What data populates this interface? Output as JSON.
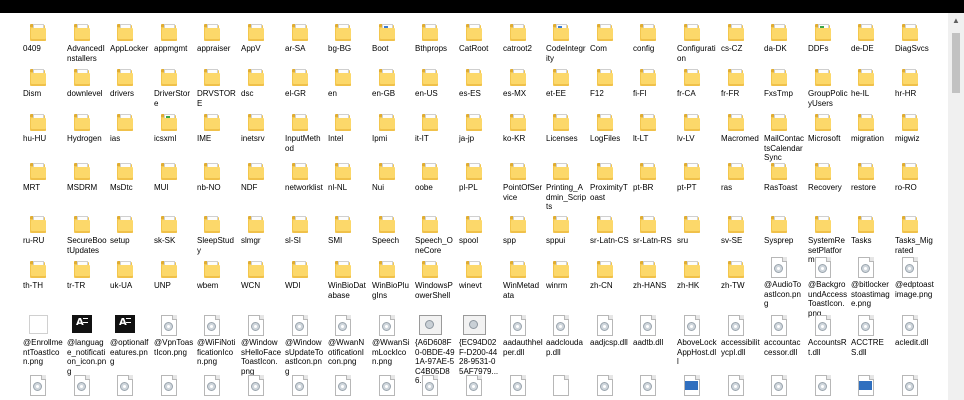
{
  "pane": {
    "rows": [
      [
        {
          "label": "0409",
          "kind": "folder"
        },
        {
          "label": "AdvancedInstallers",
          "kind": "folder"
        },
        {
          "label": "AppLocker",
          "kind": "folder"
        },
        {
          "label": "appmgmt",
          "kind": "folder"
        },
        {
          "label": "appraiser",
          "kind": "folder"
        },
        {
          "label": "AppV",
          "kind": "folder"
        },
        {
          "label": "ar-SA",
          "kind": "folder"
        },
        {
          "label": "bg-BG",
          "kind": "folder"
        },
        {
          "label": "Boot",
          "kind": "folder-doc"
        },
        {
          "label": "Bthprops",
          "kind": "folder"
        },
        {
          "label": "CatRoot",
          "kind": "folder"
        },
        {
          "label": "catroot2",
          "kind": "folder"
        },
        {
          "label": "CodeIntegrity",
          "kind": "folder-doc"
        },
        {
          "label": "Com",
          "kind": "folder"
        },
        {
          "label": "config",
          "kind": "folder"
        },
        {
          "label": "Configuration",
          "kind": "folder"
        },
        {
          "label": "cs-CZ",
          "kind": "folder"
        },
        {
          "label": "da-DK",
          "kind": "folder"
        },
        {
          "label": "DDFs",
          "kind": "folder-green"
        },
        {
          "label": "de-DE",
          "kind": "folder"
        },
        {
          "label": "DiagSvcs",
          "kind": "folder"
        }
      ],
      [
        {
          "label": "Dism",
          "kind": "folder"
        },
        {
          "label": "downlevel",
          "kind": "folder"
        },
        {
          "label": "drivers",
          "kind": "folder"
        },
        {
          "label": "DriverStore",
          "kind": "folder"
        },
        {
          "label": "DRVSTORE",
          "kind": "folder"
        },
        {
          "label": "dsc",
          "kind": "folder"
        },
        {
          "label": "el-GR",
          "kind": "folder"
        },
        {
          "label": "en",
          "kind": "folder"
        },
        {
          "label": "en-GB",
          "kind": "folder"
        },
        {
          "label": "en-US",
          "kind": "folder"
        },
        {
          "label": "es-ES",
          "kind": "folder"
        },
        {
          "label": "es-MX",
          "kind": "folder"
        },
        {
          "label": "et-EE",
          "kind": "folder"
        },
        {
          "label": "F12",
          "kind": "folder"
        },
        {
          "label": "fi-FI",
          "kind": "folder"
        },
        {
          "label": "fr-CA",
          "kind": "folder"
        },
        {
          "label": "fr-FR",
          "kind": "folder"
        },
        {
          "label": "FxsTmp",
          "kind": "folder"
        },
        {
          "label": "GroupPolicyUsers",
          "kind": "folder"
        },
        {
          "label": "he-IL",
          "kind": "folder"
        },
        {
          "label": "hr-HR",
          "kind": "folder"
        }
      ],
      [
        {
          "label": "hu-HU",
          "kind": "folder"
        },
        {
          "label": "Hydrogen",
          "kind": "folder"
        },
        {
          "label": "ias",
          "kind": "folder"
        },
        {
          "label": "icsxml",
          "kind": "folder-green"
        },
        {
          "label": "IME",
          "kind": "folder"
        },
        {
          "label": "inetsrv",
          "kind": "folder"
        },
        {
          "label": "InputMethod",
          "kind": "folder"
        },
        {
          "label": "Intel",
          "kind": "folder"
        },
        {
          "label": "Ipmi",
          "kind": "folder"
        },
        {
          "label": "it-IT",
          "kind": "folder"
        },
        {
          "label": "ja-jp",
          "kind": "folder"
        },
        {
          "label": "ko-KR",
          "kind": "folder"
        },
        {
          "label": "Licenses",
          "kind": "folder"
        },
        {
          "label": "LogFiles",
          "kind": "folder"
        },
        {
          "label": "lt-LT",
          "kind": "folder"
        },
        {
          "label": "lv-LV",
          "kind": "folder"
        },
        {
          "label": "Macromed",
          "kind": "folder"
        },
        {
          "label": "MailContactsCalendarSync",
          "kind": "folder"
        },
        {
          "label": "Microsoft",
          "kind": "folder"
        },
        {
          "label": "migration",
          "kind": "folder"
        },
        {
          "label": "migwiz",
          "kind": "folder"
        }
      ],
      [
        {
          "label": "MRT",
          "kind": "folder"
        },
        {
          "label": "MSDRM",
          "kind": "folder"
        },
        {
          "label": "MsDtc",
          "kind": "folder"
        },
        {
          "label": "MUI",
          "kind": "folder"
        },
        {
          "label": "nb-NO",
          "kind": "folder"
        },
        {
          "label": "NDF",
          "kind": "folder"
        },
        {
          "label": "networklist",
          "kind": "folder"
        },
        {
          "label": "nl-NL",
          "kind": "folder"
        },
        {
          "label": "Nui",
          "kind": "folder"
        },
        {
          "label": "oobe",
          "kind": "folder"
        },
        {
          "label": "pl-PL",
          "kind": "folder"
        },
        {
          "label": "PointOfService",
          "kind": "folder"
        },
        {
          "label": "Printing_Admin_Scripts",
          "kind": "folder"
        },
        {
          "label": "ProximityToast",
          "kind": "folder"
        },
        {
          "label": "pt-BR",
          "kind": "folder"
        },
        {
          "label": "pt-PT",
          "kind": "folder"
        },
        {
          "label": "ras",
          "kind": "folder"
        },
        {
          "label": "RasToast",
          "kind": "folder"
        },
        {
          "label": "Recovery",
          "kind": "folder"
        },
        {
          "label": "restore",
          "kind": "folder"
        },
        {
          "label": "ro-RO",
          "kind": "folder"
        }
      ],
      [
        {
          "label": "ru-RU",
          "kind": "folder"
        },
        {
          "label": "SecureBootUpdates",
          "kind": "folder"
        },
        {
          "label": "setup",
          "kind": "folder"
        },
        {
          "label": "sk-SK",
          "kind": "folder"
        },
        {
          "label": "SleepStudy",
          "kind": "folder"
        },
        {
          "label": "slmgr",
          "kind": "folder"
        },
        {
          "label": "sl-SI",
          "kind": "folder"
        },
        {
          "label": "SMI",
          "kind": "folder"
        },
        {
          "label": "Speech",
          "kind": "folder"
        },
        {
          "label": "Speech_OneCore",
          "kind": "folder"
        },
        {
          "label": "spool",
          "kind": "folder"
        },
        {
          "label": "spp",
          "kind": "folder"
        },
        {
          "label": "sppui",
          "kind": "folder"
        },
        {
          "label": "sr-Latn-CS",
          "kind": "folder"
        },
        {
          "label": "sr-Latn-RS",
          "kind": "folder"
        },
        {
          "label": "sru",
          "kind": "folder"
        },
        {
          "label": "sv-SE",
          "kind": "folder"
        },
        {
          "label": "Sysprep",
          "kind": "folder"
        },
        {
          "label": "SystemResetPlatform",
          "kind": "folder"
        },
        {
          "label": "Tasks",
          "kind": "folder"
        },
        {
          "label": "Tasks_Migrated",
          "kind": "folder"
        }
      ],
      [
        {
          "label": "th-TH",
          "kind": "folder"
        },
        {
          "label": "tr-TR",
          "kind": "folder"
        },
        {
          "label": "uk-UA",
          "kind": "folder"
        },
        {
          "label": "UNP",
          "kind": "folder"
        },
        {
          "label": "wbem",
          "kind": "folder"
        },
        {
          "label": "WCN",
          "kind": "folder"
        },
        {
          "label": "WDI",
          "kind": "folder"
        },
        {
          "label": "WinBioDatabase",
          "kind": "folder"
        },
        {
          "label": "WinBioPlugIns",
          "kind": "folder"
        },
        {
          "label": "WindowsPowerShell",
          "kind": "folder"
        },
        {
          "label": "winevt",
          "kind": "folder"
        },
        {
          "label": "WinMetadata",
          "kind": "folder"
        },
        {
          "label": "winrm",
          "kind": "folder"
        },
        {
          "label": "zh-CN",
          "kind": "folder"
        },
        {
          "label": "zh-HANS",
          "kind": "folder"
        },
        {
          "label": "zh-HK",
          "kind": "folder"
        },
        {
          "label": "zh-TW",
          "kind": "folder"
        },
        {
          "label": "@AudioToastIcon.png",
          "kind": "file"
        },
        {
          "label": "@BackgroundAccessToastIcon.png",
          "kind": "file"
        },
        {
          "label": "@bitlockerstoastimage.png",
          "kind": "file"
        },
        {
          "label": "@edptoastimage.png",
          "kind": "file"
        }
      ],
      [
        {
          "label": "@EnrollmentToastIcon.png",
          "kind": "imgwhite"
        },
        {
          "label": "@language_notification_icon.png",
          "kind": "imgblack"
        },
        {
          "label": "@optionalfeatures.png",
          "kind": "imgblack"
        },
        {
          "label": "@VpnToastIcon.png",
          "kind": "file"
        },
        {
          "label": "@WiFiNotificationIcon.png",
          "kind": "file"
        },
        {
          "label": "@WindowsHelloFaceToastIcon.png",
          "kind": "file"
        },
        {
          "label": "@WindowsUpdateToastIcon.png",
          "kind": "file"
        },
        {
          "label": "@WwanNotificationIcon.png",
          "kind": "file"
        },
        {
          "label": "@WwanSimLockIcon.png",
          "kind": "file"
        },
        {
          "label": "{A6D608F0-0BDE-491A-97AE-5C4B05D86...",
          "kind": "imgwide"
        },
        {
          "label": "{EC94D02F-D200-4428-9531-05AF7979...",
          "kind": "imgwide"
        },
        {
          "label": "aadauthhelper.dll",
          "kind": "file"
        },
        {
          "label": "aadcloudap.dll",
          "kind": "file"
        },
        {
          "label": "aadjcsp.dll",
          "kind": "file"
        },
        {
          "label": "aadtb.dll",
          "kind": "file"
        },
        {
          "label": "AboveLockAppHost.dll",
          "kind": "file"
        },
        {
          "label": "accessibilitycpl.dll",
          "kind": "file"
        },
        {
          "label": "accountaccessor.dll",
          "kind": "file"
        },
        {
          "label": "AccountsRt.dll",
          "kind": "file"
        },
        {
          "label": "ACCTRES.dll",
          "kind": "file"
        },
        {
          "label": "acledit.dll",
          "kind": "file"
        }
      ],
      [
        {
          "label": "",
          "kind": "file"
        },
        {
          "label": "",
          "kind": "file"
        },
        {
          "label": "",
          "kind": "file"
        },
        {
          "label": "",
          "kind": "file"
        },
        {
          "label": "",
          "kind": "file"
        },
        {
          "label": "",
          "kind": "file"
        },
        {
          "label": "",
          "kind": "file"
        },
        {
          "label": "",
          "kind": "file"
        },
        {
          "label": "",
          "kind": "file"
        },
        {
          "label": "",
          "kind": "file"
        },
        {
          "label": "",
          "kind": "file"
        },
        {
          "label": "",
          "kind": "file"
        },
        {
          "label": "",
          "kind": "file-plain"
        },
        {
          "label": "",
          "kind": "file"
        },
        {
          "label": "",
          "kind": "file"
        },
        {
          "label": "",
          "kind": "file-blue"
        },
        {
          "label": "",
          "kind": "file"
        },
        {
          "label": "",
          "kind": "file"
        },
        {
          "label": "",
          "kind": "file"
        },
        {
          "label": "",
          "kind": "file-blue"
        },
        {
          "label": "",
          "kind": "file"
        }
      ]
    ]
  },
  "colors": {
    "folder": "#f3c64d",
    "background": "#ffffff",
    "frame": "#000000"
  }
}
